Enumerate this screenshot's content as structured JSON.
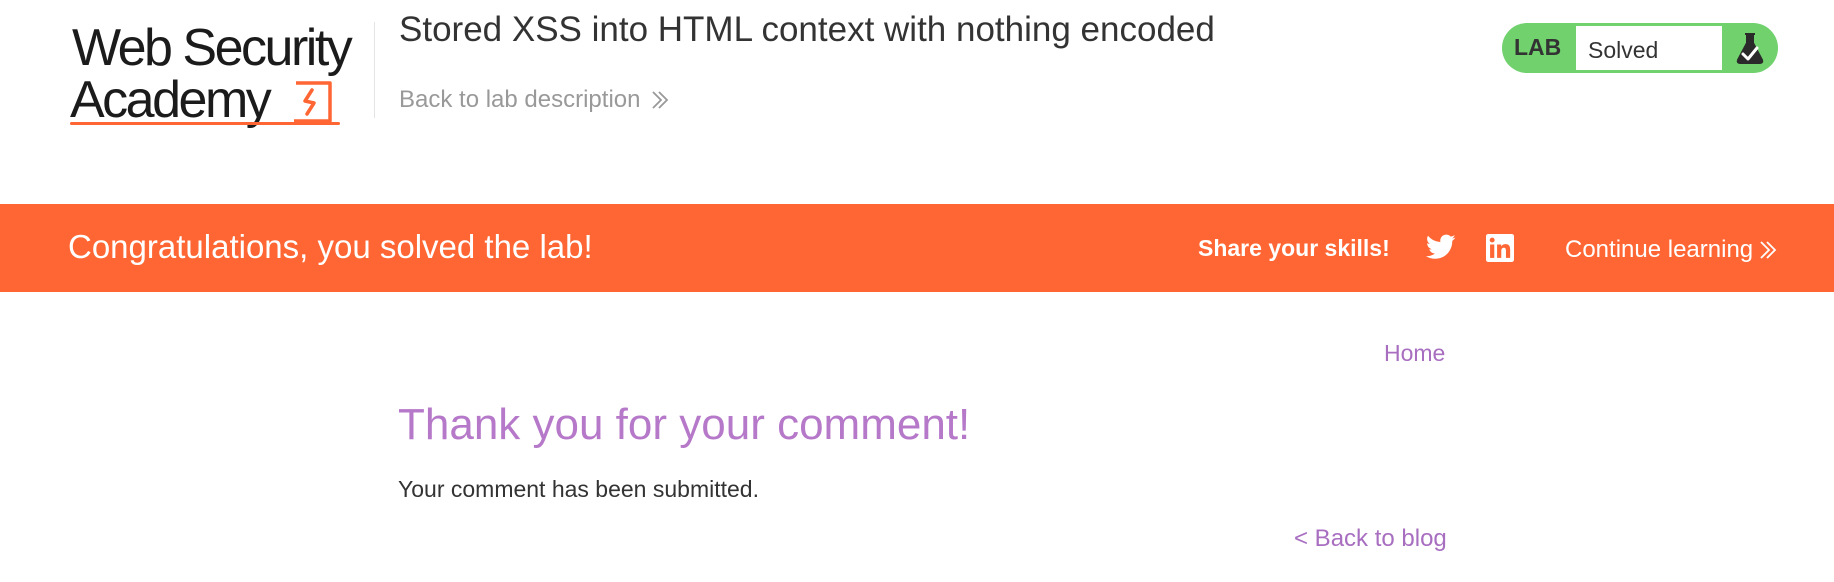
{
  "header": {
    "logo": {
      "line1": "Web Security",
      "line2": "Academy"
    },
    "lab_title": "Stored XSS into HTML context with nothing encoded",
    "back_link": "Back to lab description",
    "lab_status": {
      "tag": "LAB",
      "value": "Solved",
      "icon": "flask-icon"
    }
  },
  "banner": {
    "message": "Congratulations, you solved the lab!",
    "share_label": "Share your skills!",
    "share_icons": [
      "twitter-icon",
      "linkedin-icon"
    ],
    "continue_label": "Continue learning"
  },
  "content": {
    "nav_home": "Home",
    "heading": "Thank you for your comment!",
    "message": "Your comment has been submitted.",
    "back_to_blog": "< Back to blog"
  },
  "colors": {
    "accent_orange": "#ff6633",
    "lab_green": "#70d16d",
    "link_purple": "#a86ec0",
    "heading_purple": "#b678c9",
    "text_dark": "#333333",
    "text_muted": "#999999"
  }
}
